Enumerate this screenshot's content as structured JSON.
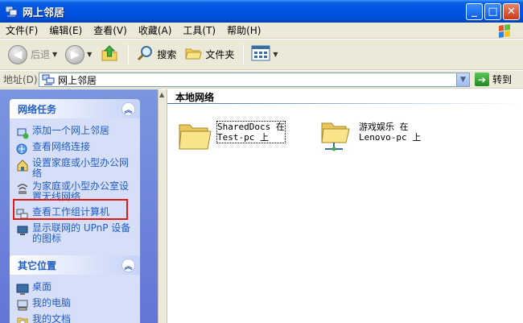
{
  "window": {
    "title": "网上邻居",
    "buttons": {
      "minimize": "_",
      "maximize": "□",
      "close": "✕"
    }
  },
  "menubar": {
    "items": [
      "文件(F)",
      "编辑(E)",
      "查看(V)",
      "收藏(A)",
      "工具(T)",
      "帮助(H)"
    ]
  },
  "toolbar": {
    "back": "后退",
    "search": "搜索",
    "folders": "文件夹"
  },
  "addressbar": {
    "label": "地址(D)",
    "value": "网上邻居",
    "go": "转到"
  },
  "leftpane": {
    "network_tasks": {
      "title": "网络任务",
      "items": [
        "添加一个网上邻居",
        "查看网络连接",
        "设置家庭或小型办公网络",
        "为家庭或小型办公室设置无线网络",
        "查看工作组计算机",
        "显示联网的 UPnP 设备的图标"
      ]
    },
    "other_places": {
      "title": "其它位置",
      "items": [
        "桌面",
        "我的电脑",
        "我的文档"
      ]
    }
  },
  "rightpane": {
    "group_title": "本地网络",
    "items": [
      {
        "name": "SharedDocs 在\nTest-pc 上",
        "icon": "folder-icon"
      },
      {
        "name": "游戏娱乐 在\nLenovo-pc 上",
        "icon": "network-share-icon"
      }
    ]
  },
  "colors": {
    "title_bar": "#0054e3",
    "left_pane": "#6f86da",
    "task_link": "#215dc6",
    "highlight": "#e01818"
  }
}
